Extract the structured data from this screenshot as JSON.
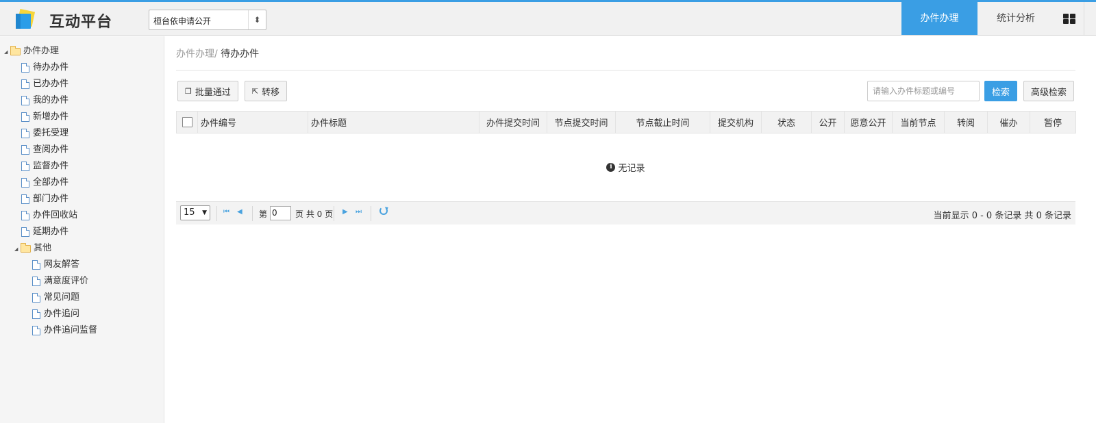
{
  "header": {
    "brand": "互动平台",
    "org_select": "桓台依申请公开",
    "nav": [
      {
        "label": "办件办理",
        "active": true
      },
      {
        "label": "统计分析",
        "active": false
      }
    ],
    "grid_icon": "grid-icon",
    "accent_color": "#3a9ee4"
  },
  "sidebar": {
    "root": "办件办理",
    "items": [
      "待办办件",
      "已办办件",
      "我的办件",
      "新增办件",
      "委托受理",
      "查阅办件",
      "监督办件",
      "全部办件",
      "部门办件",
      "办件回收站",
      "延期办件"
    ],
    "other_folder": "其他",
    "other_items": [
      "网友解答",
      "满意度评价",
      "常见问题",
      "办件追问",
      "办件追问监督"
    ]
  },
  "main": {
    "breadcrumb_parent": "办件办理/",
    "breadcrumb_current": "待办办件",
    "toolbar": {
      "batch_label": "批量通过",
      "transfer_label": "转移",
      "search_placeholder": "请输入办件标题或编号",
      "search_label": "检索",
      "advanced_label": "高级检索"
    },
    "table": {
      "columns": [
        "办件编号",
        "办件标题",
        "办件提交时间",
        "节点提交时间",
        "节点截止时间",
        "提交机构",
        "状态",
        "公开",
        "愿意公开",
        "当前节点",
        "转阅",
        "催办",
        "暂停"
      ],
      "rows": [],
      "empty_text": "无记录"
    },
    "pager": {
      "page_size": "15",
      "page_prefix": "第",
      "page_value": "0",
      "page_suffix": "页 共 0 页",
      "summary": "当前显示 0 - 0 条记录 共 0 条记录"
    }
  }
}
